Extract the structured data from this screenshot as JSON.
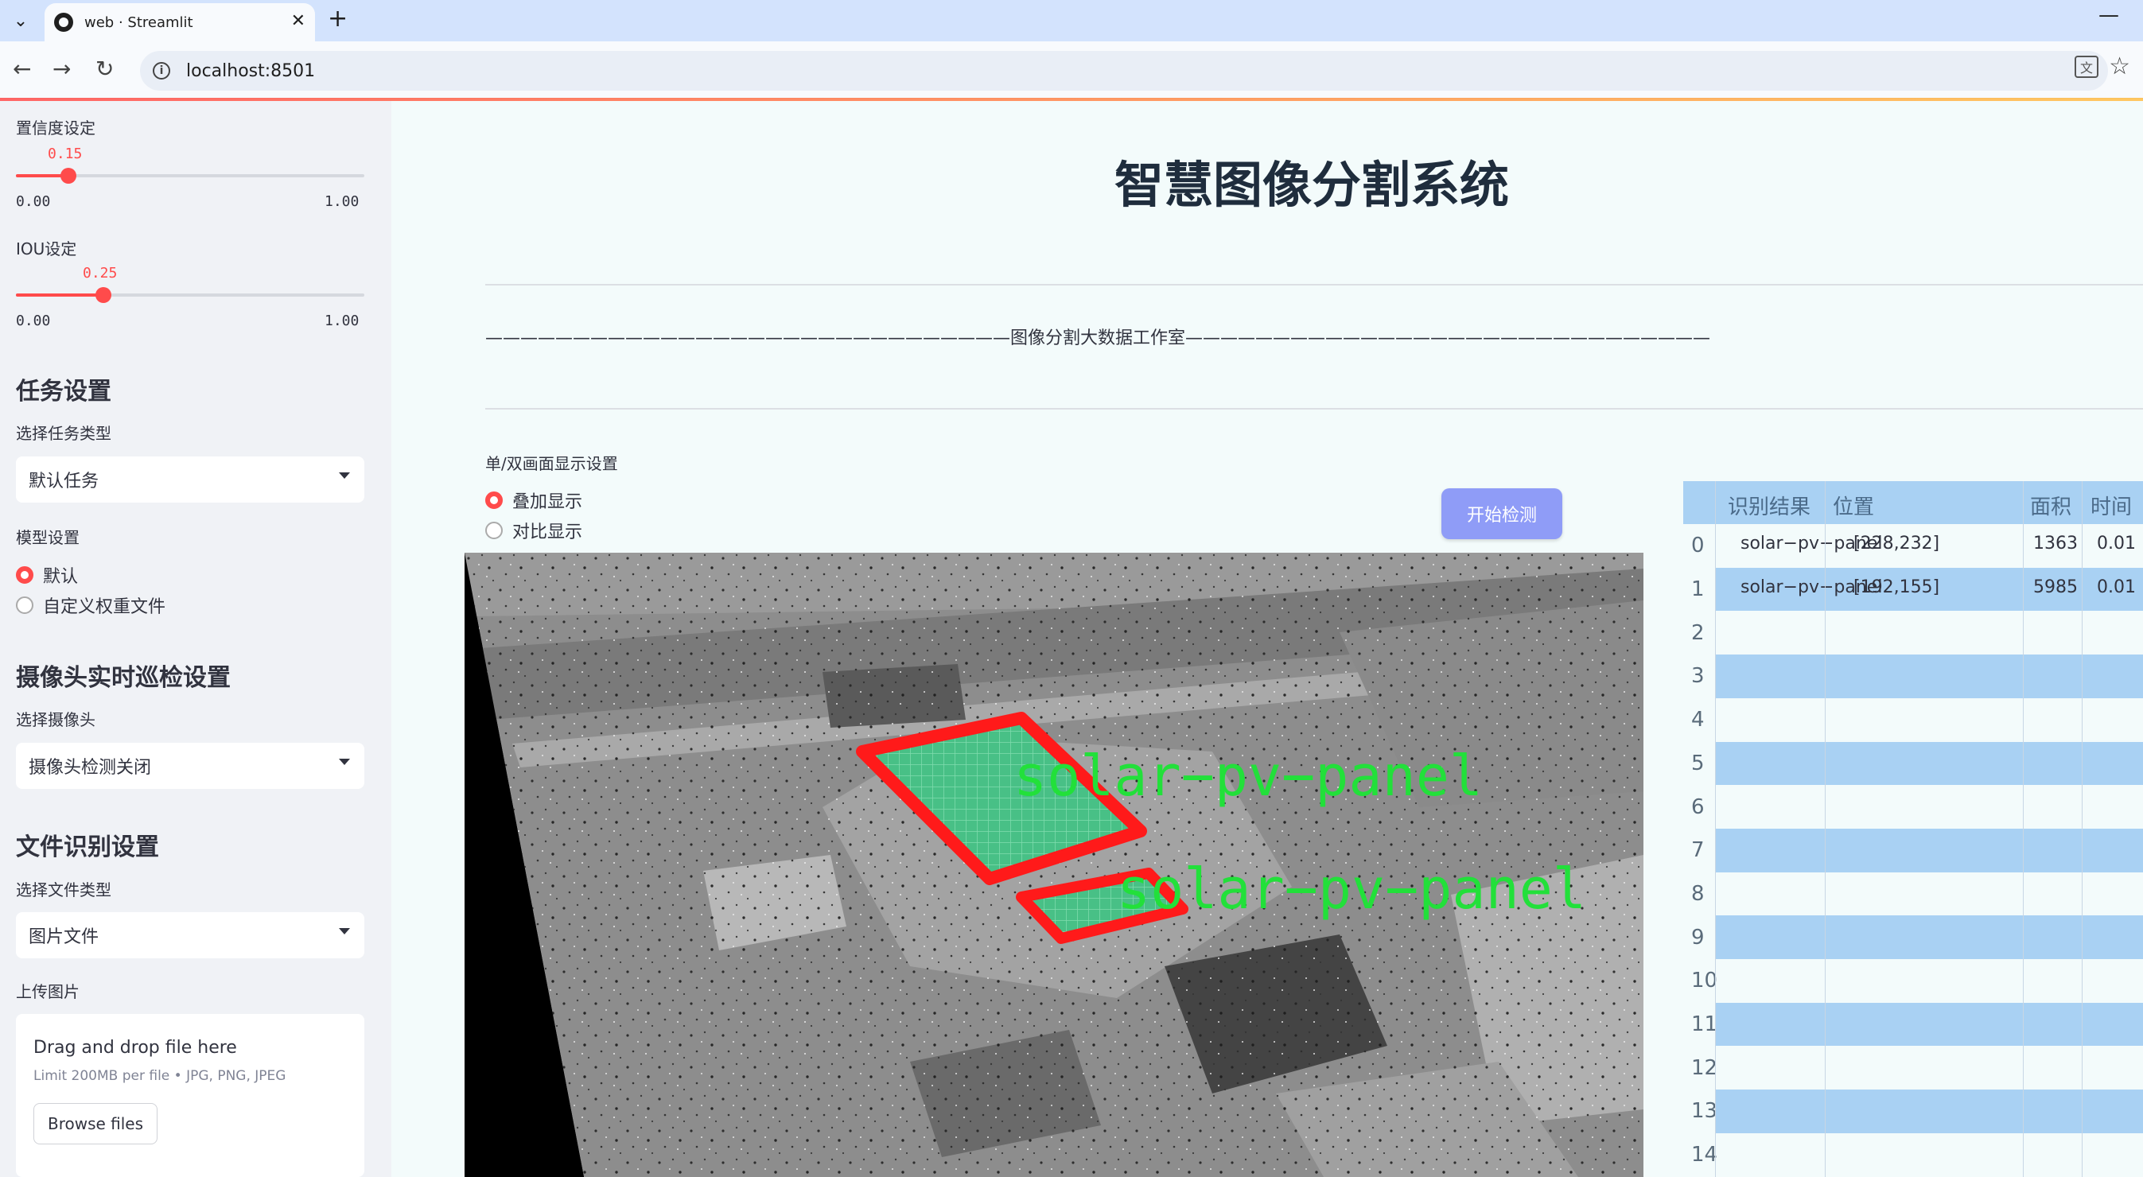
{
  "browser": {
    "tab_title": "web · Streamlit",
    "url": "localhost:8501"
  },
  "sidebar": {
    "confidence": {
      "label": "置信度设定",
      "value": "0.15",
      "value_num": 0.15,
      "min": "0.00",
      "max": "1.00"
    },
    "iou": {
      "label": "IOU设定",
      "value": "0.25",
      "value_num": 0.25,
      "min": "0.00",
      "max": "1.00"
    },
    "task_heading": "任务设置",
    "task_type_label": "选择任务类型",
    "task_type_value": "默认任务",
    "model_label": "模型设置",
    "model_options": [
      "默认",
      "自定义权重文件"
    ],
    "model_selected": "默认",
    "camera_heading": "摄像头实时巡检设置",
    "camera_label": "选择摄像头",
    "camera_value": "摄像头检测关闭",
    "file_heading": "文件识别设置",
    "file_type_label": "选择文件类型",
    "file_type_value": "图片文件",
    "upload_label": "上传图片",
    "upload_title": "Drag and drop file here",
    "upload_sub": "Limit 200MB per file • JPG, PNG, JPEG",
    "browse_label": "Browse files"
  },
  "main": {
    "title": "智慧图像分割系统",
    "banner": "——————————————————————————————图像分割大数据工作室——————————————————————————————",
    "display_label": "单/双画面显示设置",
    "display_options": [
      "叠加显示",
      "对比显示"
    ],
    "display_selected": "叠加显示",
    "start_button": "开始检测",
    "detections": [
      "solar−pv−panel",
      "solar−pv−panel"
    ]
  },
  "table": {
    "headers": [
      "识别结果",
      "位置",
      "面积",
      "时间"
    ],
    "rows": [
      {
        "index": "0",
        "result": "solar−pv−panel",
        "position": "[228,232]",
        "area": "1363",
        "time": "0.01"
      },
      {
        "index": "1",
        "result": "solar−pv−panel",
        "position": "[192,155]",
        "area": "5985",
        "time": "0.01"
      },
      {
        "index": "2"
      },
      {
        "index": "3"
      },
      {
        "index": "4"
      },
      {
        "index": "5"
      },
      {
        "index": "6"
      },
      {
        "index": "7"
      },
      {
        "index": "8"
      },
      {
        "index": "9"
      },
      {
        "index": "10"
      },
      {
        "index": "11"
      },
      {
        "index": "12"
      },
      {
        "index": "13"
      },
      {
        "index": "14"
      }
    ]
  },
  "colors": {
    "accent": "#ff4b4b",
    "button": "#8f9cf7",
    "table_stripe": "#a9d1f3",
    "mask_border": "#ff1a1a",
    "mask_fill": "#3cc07a",
    "label_text": "#22e03a"
  }
}
